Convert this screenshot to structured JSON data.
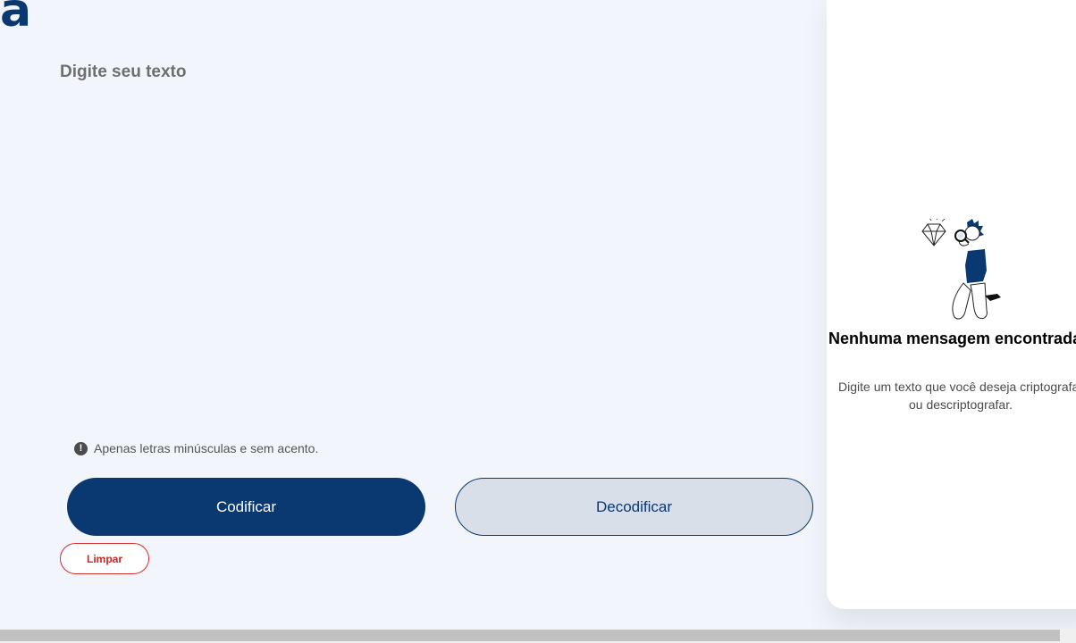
{
  "brand": {
    "logo_text": "a"
  },
  "editor": {
    "placeholder": "Digite seu texto",
    "value": ""
  },
  "hint": {
    "icon": "exclamation-circle-icon",
    "text": "Apenas letras minúsculas e sem acento."
  },
  "buttons": {
    "encrypt_label": "Codificar",
    "decrypt_label": "Decodificar",
    "clear_label": "Limpar"
  },
  "output": {
    "illustration": "person-with-magnifier-and-diamond-illustration",
    "title": "Nenhuma mensagem encontrada",
    "description": "Digite um texto que você deseja criptografar ou descriptografar."
  },
  "colors": {
    "background": "#f2f5fc",
    "primary": "#0a3871",
    "secondary_button": "#d8dfe8",
    "danger": "#d32f2f",
    "panel": "#ffffff"
  }
}
